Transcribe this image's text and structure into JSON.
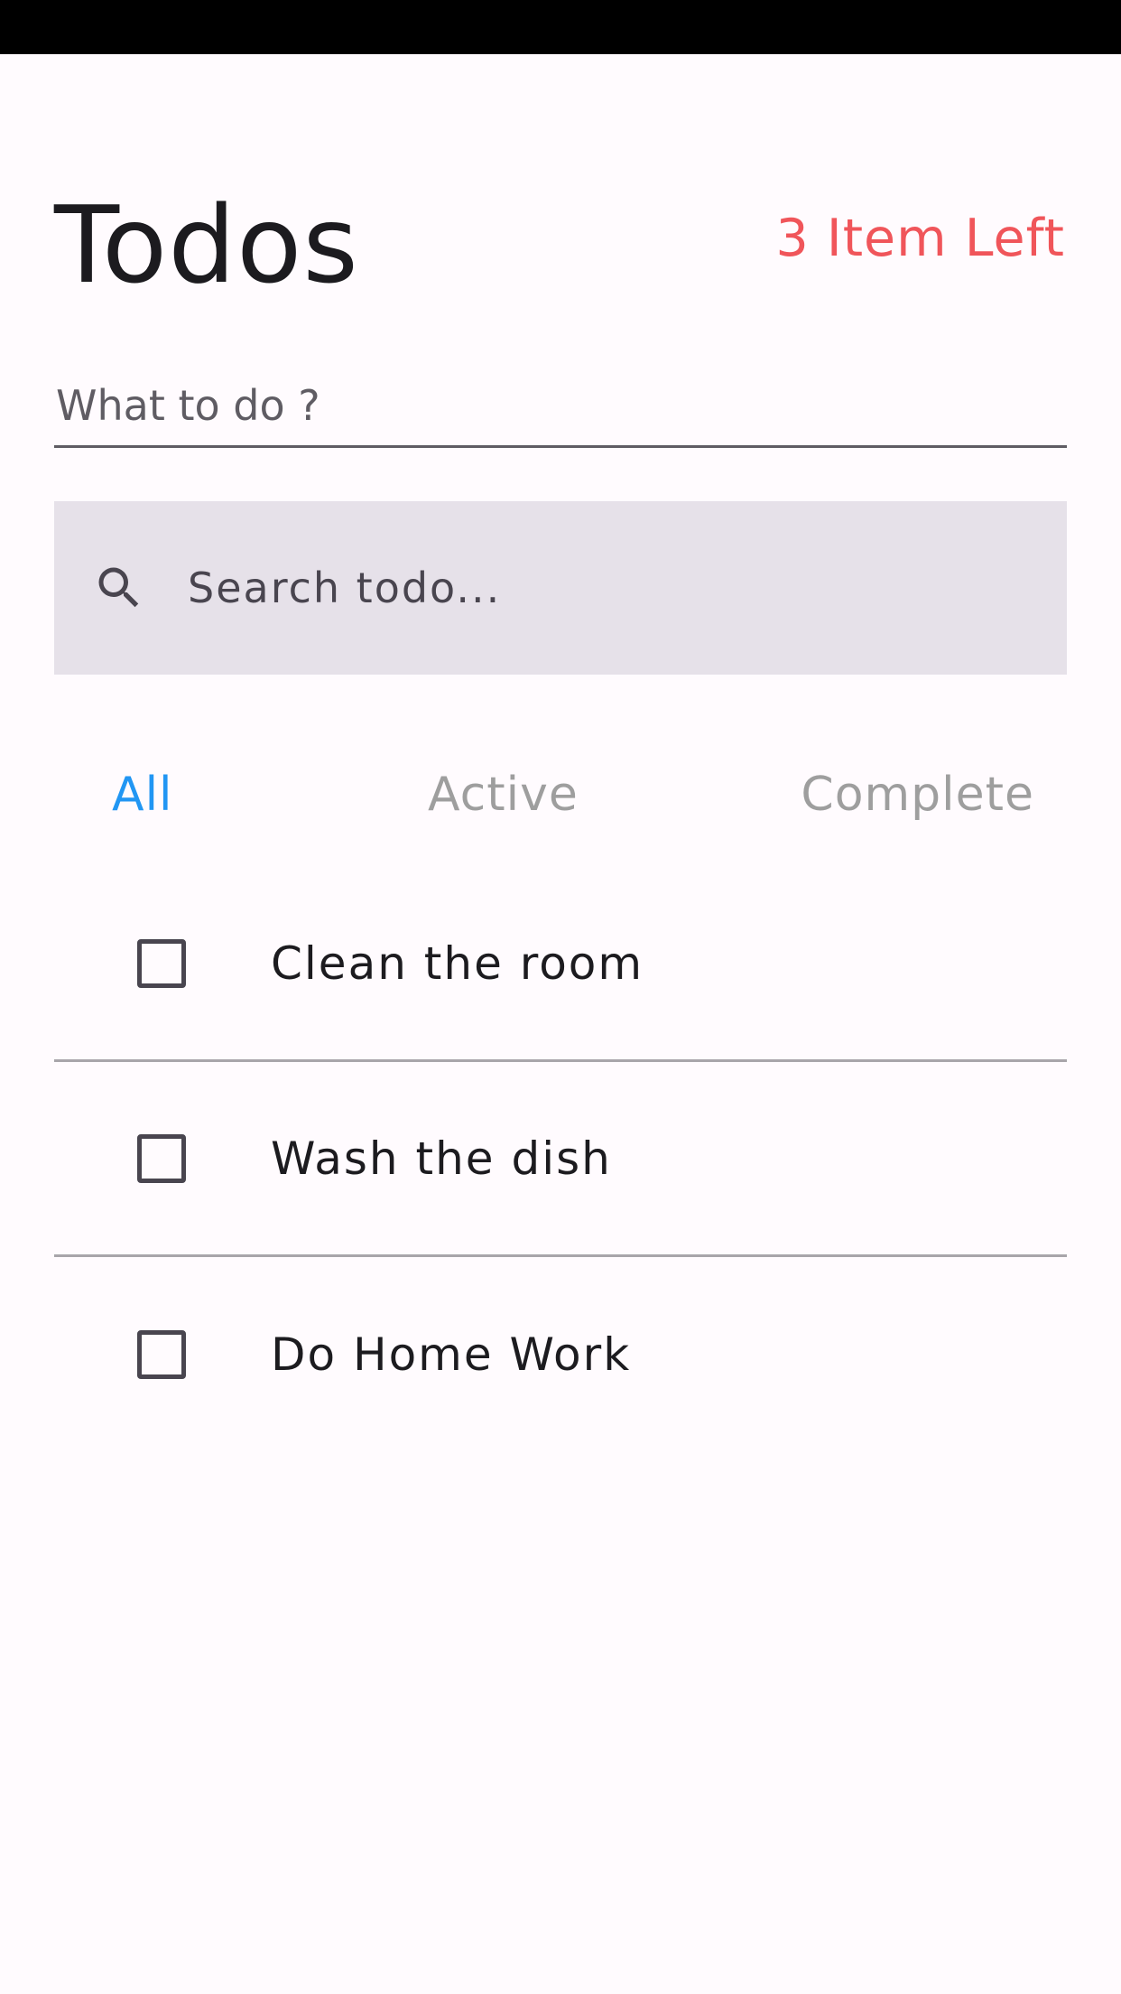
{
  "header": {
    "title": "Todos",
    "items_left": "3 Item Left"
  },
  "new_todo": {
    "placeholder": "What to do ?"
  },
  "search": {
    "placeholder": "Search todo...",
    "icon": "search-icon"
  },
  "tabs": [
    {
      "label": "All",
      "selected": true
    },
    {
      "label": "Active",
      "selected": false
    },
    {
      "label": "Complete",
      "selected": false
    }
  ],
  "todos": [
    {
      "label": "Clean the room",
      "checked": false
    },
    {
      "label": "Wash the dish",
      "checked": false
    },
    {
      "label": "Do Home Work",
      "checked": false
    }
  ],
  "colors": {
    "accent": "#2196f3",
    "items_left": "#f0555a",
    "search_bg": "#e6e1e9",
    "background": "#fffbfe"
  }
}
